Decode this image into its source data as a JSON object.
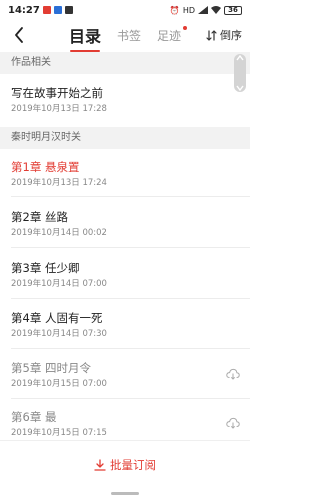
{
  "status_bar": {
    "time": "14:27",
    "right_text": "HD",
    "battery": "36"
  },
  "nav": {
    "tabs": [
      {
        "label": "目录",
        "active": true
      },
      {
        "label": "书签",
        "active": false
      },
      {
        "label": "足迹",
        "active": false,
        "badge": true
      }
    ],
    "sort_label": "倒序"
  },
  "sections": [
    {
      "title": "作品相关",
      "items": [
        {
          "title": "写在故事开始之前",
          "date": "2019年10月13日 17:28",
          "state": "normal"
        }
      ]
    },
    {
      "title": "秦时明月汉时关",
      "items": [
        {
          "title": "第1章 悬泉置",
          "date": "2019年10月13日 17:24",
          "state": "current"
        },
        {
          "title": "第2章 丝路",
          "date": "2019年10月14日 00:02",
          "state": "normal"
        },
        {
          "title": "第3章 任少卿",
          "date": "2019年10月14日 07:00",
          "state": "normal"
        },
        {
          "title": "第4章 人固有一死",
          "date": "2019年10月14日 07:30",
          "state": "normal"
        },
        {
          "title": "第5章 四时月令",
          "date": "2019年10月15日 07:00",
          "state": "locked"
        },
        {
          "title": "第6章 最",
          "date": "2019年10月15日 07:15",
          "state": "locked"
        }
      ]
    }
  ],
  "bottom": {
    "batch_label": "批量订阅"
  },
  "colors": {
    "accent": "#e23c33",
    "section_bg": "#f2f2f2"
  }
}
